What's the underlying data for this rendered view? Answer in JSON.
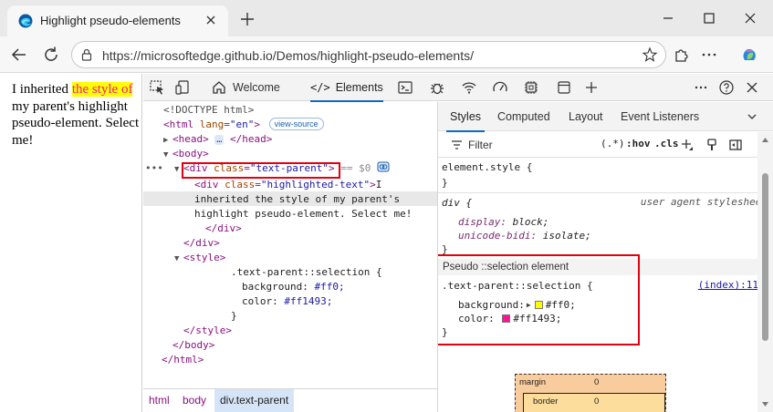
{
  "browser": {
    "tab_title": "Highlight pseudo-elements",
    "url": "https://microsoftedge.github.io/Demos/highlight-pseudo-elements/"
  },
  "page": {
    "text_before": "I inherited ",
    "text_highlighted": "the style of",
    "text_after": " my parent's highlight pseudo-element. Select me!",
    "selection_background": "#ffff00",
    "selection_color": "#ff1493"
  },
  "devtools": {
    "tabs": {
      "welcome": "Welcome",
      "elements": "Elements"
    },
    "tree": {
      "doctype": "<!DOCTYPE html>",
      "html_open_tag": "<html",
      "html_attr": "lang",
      "html_attr_val": "\"en\"",
      "html_close_bracket": ">",
      "view_source": "view-source",
      "head": "<head>",
      "head_close": "</head>",
      "body": "<body>",
      "div_open": "<div",
      "div_attr": "class",
      "div_parent_val": "\"text-parent\"",
      "gt": ">",
      "eq_dollar": "== $0",
      "div_child_val": "\"highlighted-text\"",
      "child_text_1": "I",
      "child_text_2": "inherited the style of my parent's",
      "child_text_3": "highlight pseudo-element. Select me!",
      "div_close": "</div>",
      "style_open": "<style>",
      "css_selector": ".text-parent::selection {",
      "css_bg_prop": "background:",
      "css_bg_val": "#ff0;",
      "css_color_prop": "color:",
      "css_color_val": "#ff1493;",
      "css_close": "}",
      "style_close": "</style>",
      "body_close": "</body>",
      "html_close": "</html>",
      "ellipsis": "…"
    },
    "breadcrumb": [
      "html",
      "body",
      "div.text-parent"
    ],
    "styles_tabs": [
      "Styles",
      "Computed",
      "Layout",
      "Event Listeners"
    ],
    "filter": {
      "label": "Filter",
      "pseudo_toggle": "(.*)",
      "hov": ":hov",
      "cls": ".cls"
    },
    "rules": {
      "element_style": "element.style {",
      "close": "}",
      "ua_selector": "div {",
      "ua_source": "user agent stylesheet",
      "ua_display_prop": "display:",
      "ua_display_val": "block;",
      "ua_bidi_prop": "unicode-bidi:",
      "ua_bidi_val": "isolate;",
      "pseudo_header": "Pseudo ::selection element",
      "pseudo_selector": ".text-parent::selection {",
      "pseudo_source": "(index):11",
      "bg_prop": "background:",
      "bg_val": "#ff0;",
      "color_prop": "color:",
      "color_val": "#ff1493;"
    },
    "box_model": {
      "margin": "margin",
      "margin_val": "0",
      "border": "border",
      "border_val": "0"
    }
  },
  "colors": {
    "accent": "#0f6cbd",
    "highlight_box": "#e3000f",
    "swatch_yellow": "#ffff00",
    "swatch_pink": "#ff1493"
  }
}
